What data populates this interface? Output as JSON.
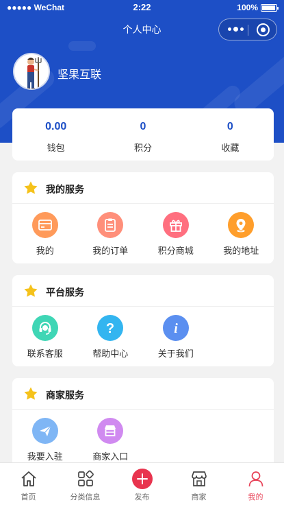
{
  "status_bar": {
    "carrier": "●●●●● WeChat",
    "time": "2:22",
    "battery": "100%"
  },
  "nav": {
    "title": "个人中心"
  },
  "profile": {
    "name": "坚果互联"
  },
  "stats": [
    {
      "value": "0.00",
      "label": "钱包"
    },
    {
      "value": "0",
      "label": "积分"
    },
    {
      "value": "0",
      "label": "收藏"
    }
  ],
  "my_services": {
    "title": "我的服务",
    "items": [
      {
        "label": "我的",
        "icon": "card-icon",
        "color": "#ff9a5a"
      },
      {
        "label": "我的订单",
        "icon": "clipboard-icon",
        "color": "#ff8f7a"
      },
      {
        "label": "积分商城",
        "icon": "gift-icon",
        "color": "#ff6f7f"
      },
      {
        "label": "我的地址",
        "icon": "location-pin-icon",
        "color": "#ff9e2b"
      }
    ]
  },
  "platform_services": {
    "title": "平台服务",
    "items": [
      {
        "label": "联系客服",
        "icon": "headset-icon",
        "color": "#3fd6b5"
      },
      {
        "label": "帮助中心",
        "icon": "question-icon",
        "color": "#33b5f0"
      },
      {
        "label": "关于我们",
        "icon": "info-icon",
        "color": "#5b8ff0"
      }
    ]
  },
  "merchant_services": {
    "title": "商家服务",
    "items": [
      {
        "label": "我要入驻",
        "icon": "paper-plane-icon",
        "color": "#7fb6f5"
      },
      {
        "label": "商家入口",
        "icon": "store-icon",
        "color": "#d08af0"
      }
    ]
  },
  "tabbar": [
    {
      "label": "首页",
      "icon": "home-icon"
    },
    {
      "label": "分类信息",
      "icon": "category-grid-icon"
    },
    {
      "label": "发布",
      "icon": "plus-icon"
    },
    {
      "label": "商家",
      "icon": "shop-icon"
    },
    {
      "label": "我的",
      "icon": "user-icon",
      "active": true
    }
  ],
  "colors": {
    "primary": "#1d4fc6",
    "accent": "#e8455a",
    "star": "#f5c21b"
  }
}
